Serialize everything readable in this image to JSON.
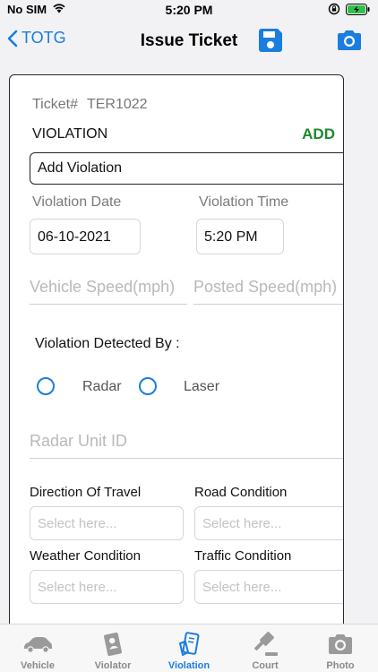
{
  "status_bar": {
    "carrier": "No SIM",
    "time": "5:20 PM"
  },
  "nav": {
    "back_label": "TOTG",
    "title": "Issue Ticket",
    "save_icon": "save-icon",
    "camera_icon": "camera-icon"
  },
  "form": {
    "ticket_label": "Ticket#",
    "ticket_number": "TER1022",
    "violation_label": "VIOLATION",
    "add_label": "ADD",
    "add_violation_text": "Add Violation",
    "violation_date_label": "Violation Date",
    "violation_date_value": "06-10-2021",
    "violation_time_label": "Violation Time",
    "violation_time_value": "5:20 PM",
    "vehicle_speed_placeholder": "Vehicle Speed(mph)",
    "posted_speed_placeholder": "Posted Speed(mph)",
    "detected_by_label": "Violation Detected By :",
    "radar_label": "Radar",
    "laser_label": "Laser",
    "radar_unit_placeholder": "Radar Unit ID",
    "direction_label": "Direction Of Travel",
    "road_condition_label": "Road Condition",
    "weather_label": "Weather Condition",
    "traffic_label": "Traffic Condition",
    "select_placeholder": "Select here..."
  },
  "tabs": [
    {
      "label": "Vehicle",
      "icon": "car-icon",
      "active": false
    },
    {
      "label": "Violator",
      "icon": "id-card-icon",
      "active": false
    },
    {
      "label": "Violation",
      "icon": "ticket-icon",
      "active": true
    },
    {
      "label": "Court",
      "icon": "gavel-icon",
      "active": false
    },
    {
      "label": "Photo",
      "icon": "camera-icon",
      "active": false
    }
  ],
  "colors": {
    "accent": "#1a7de0",
    "add_green": "#1b8a2e"
  }
}
